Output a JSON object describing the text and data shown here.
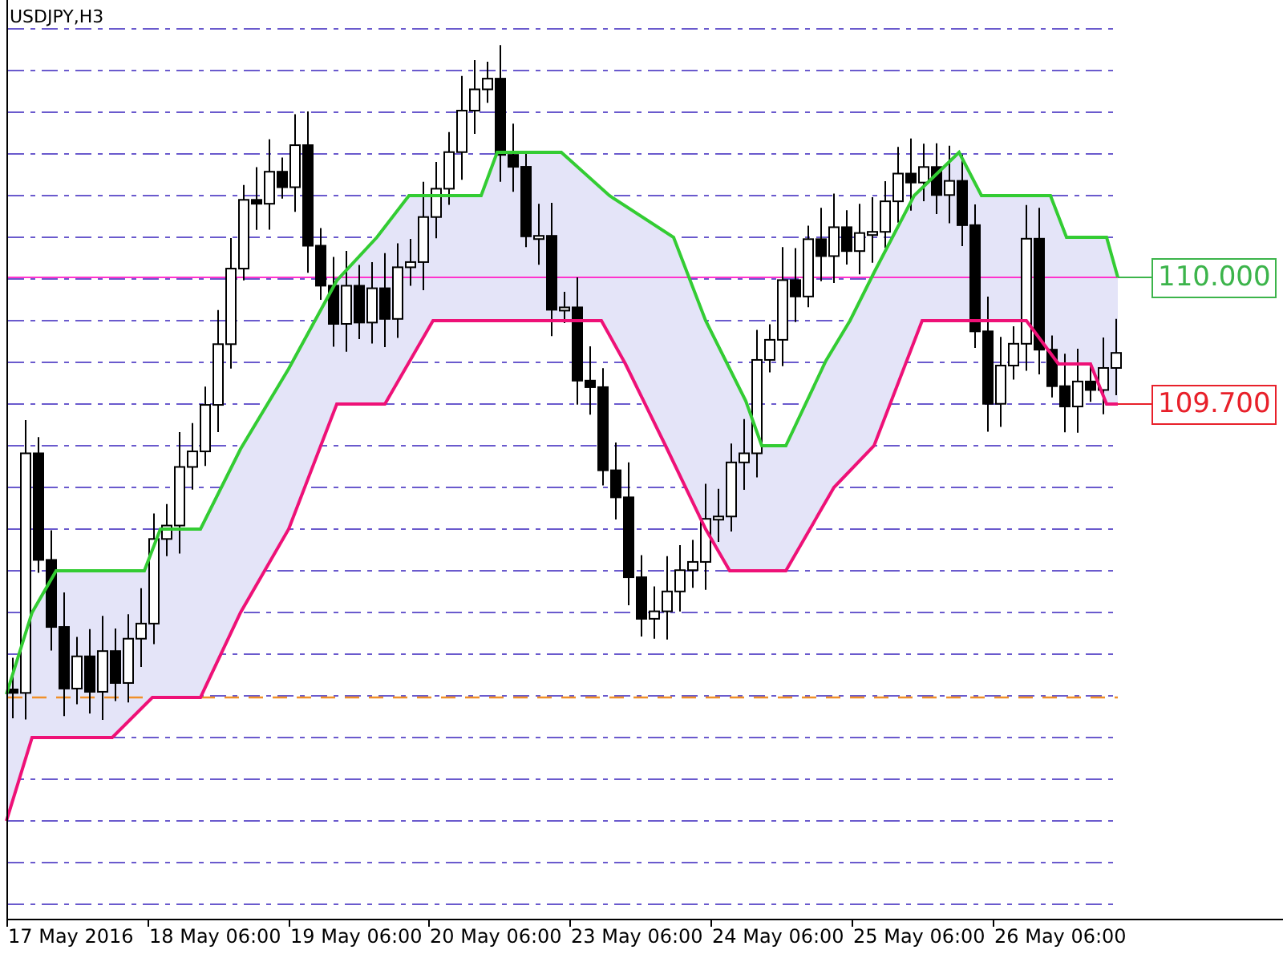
{
  "chart": {
    "title": "USDJPY,H3"
  },
  "price_labels": [
    {
      "text": "110.000",
      "color": "#3cb44b"
    },
    {
      "text": "109.700",
      "color": "#e8202a"
    }
  ],
  "time_axis": {
    "labels": [
      "17 May 2016",
      "18 May 06:00",
      "19 May 06:00",
      "20 May 06:00",
      "23 May 06:00",
      "24 May 06:00",
      "25 May 06:00",
      "26 May 06:00"
    ]
  }
}
